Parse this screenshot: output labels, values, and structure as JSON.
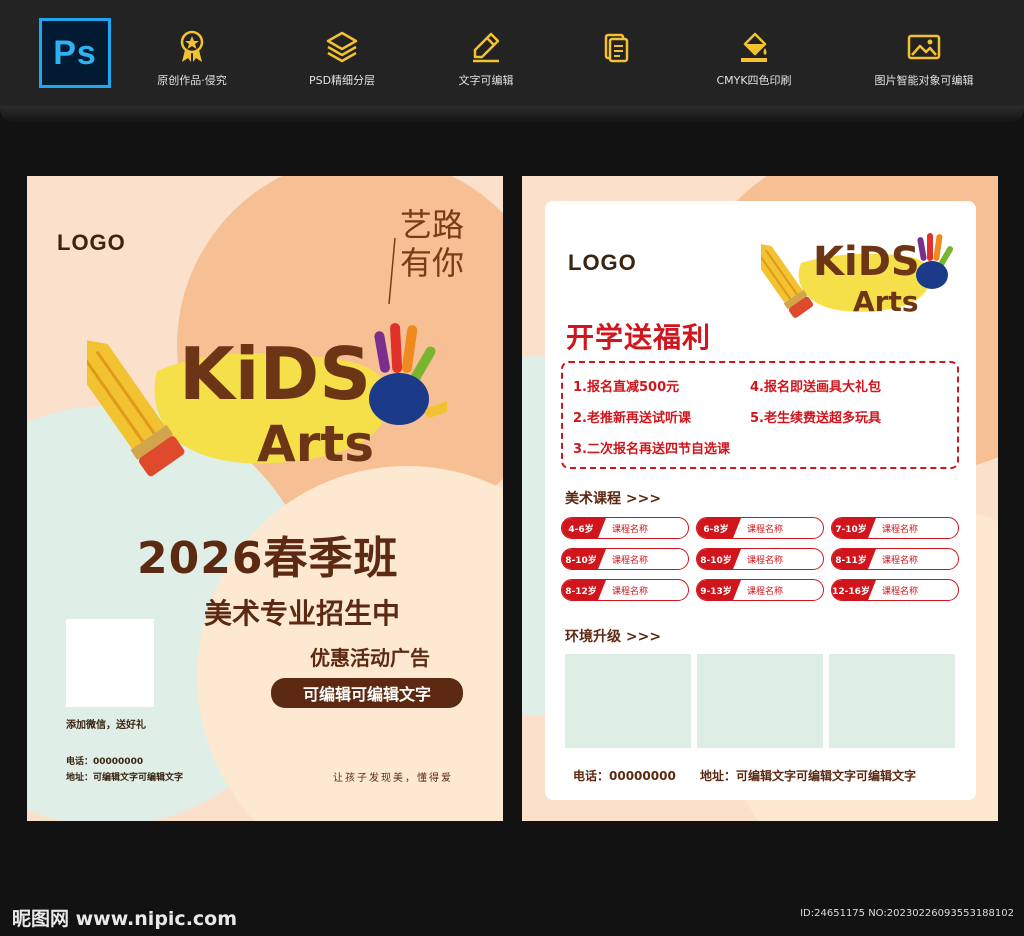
{
  "toolbar": {
    "app_badge": "Ps",
    "features": [
      {
        "icon": "award-icon",
        "label": "原创作品·侵究"
      },
      {
        "icon": "layers-icon",
        "label": "PSD精细分层"
      },
      {
        "icon": "pencil-icon",
        "label": "文字可编辑"
      },
      {
        "icon": "document-icon",
        "label": "CMYK四色印刷"
      },
      {
        "icon": "image-icon",
        "label": "图片智能对象可编辑"
      }
    ],
    "accent_color": "#f2c230"
  },
  "poster_front": {
    "logo": "LOGO",
    "slogan_line1": "艺路",
    "slogan_line2": "有你",
    "brand_line1": "KiDS",
    "brand_line2": "Arts",
    "headline": "2026春季班",
    "subheadline": "美术专业招生中",
    "promo": "优惠活动广告",
    "pill_text": "可编辑可编辑文字",
    "qr_caption": "添加微信，送好礼",
    "phone": "电话：00000000",
    "address": "地址：可编辑文字可编辑文字",
    "tagline": "让孩子发现美，懂得爱",
    "colors": {
      "brown": "#5c2a12",
      "peach": "#fbe0cb",
      "mint": "#deede4"
    }
  },
  "poster_back": {
    "logo": "LOGO",
    "brand_line1": "KiDS",
    "brand_line2": "Arts",
    "benefit_title": "开学送福利",
    "benefits": [
      "1.报名直减500元",
      "4.报名即送画具大礼包",
      "2.老推新再送试听课",
      "5.老生续费送超多玩具",
      "3.二次报名再送四节自选课"
    ],
    "courses_title": "美术课程 >>>",
    "courses": [
      {
        "age": "4-6岁",
        "name": "课程名称"
      },
      {
        "age": "6-8岁",
        "name": "课程名称"
      },
      {
        "age": "7-10岁",
        "name": "课程名称"
      },
      {
        "age": "8-10岁",
        "name": "课程名称"
      },
      {
        "age": "8-10岁",
        "name": "课程名称"
      },
      {
        "age": "8-11岁",
        "name": "课程名称"
      },
      {
        "age": "8-12岁",
        "name": "课程名称"
      },
      {
        "age": "9-13岁",
        "name": "课程名称"
      },
      {
        "age": "12-16岁",
        "name": "课程名称"
      }
    ],
    "environment_title": "环境升级 >>>",
    "phone": "电话：00000000",
    "address": "地址：可编辑文字可编辑文字可编辑文字",
    "colors": {
      "red": "#d0151c"
    }
  },
  "watermark": {
    "site": "昵图网 www.nipic.com",
    "id": "ID:24651175 NO:20230226093553188102"
  }
}
